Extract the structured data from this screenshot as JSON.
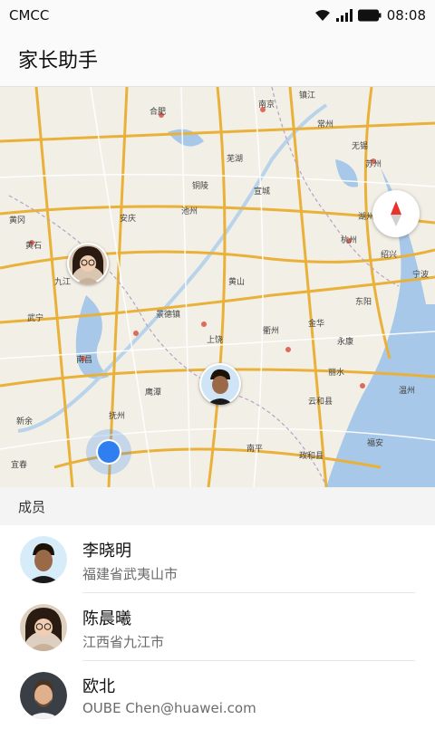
{
  "status": {
    "carrier": "CMCC",
    "time": "08:08"
  },
  "app": {
    "title": "家长助手"
  },
  "map": {
    "labels": [
      "合肥",
      "南京",
      "镇江",
      "常州",
      "无锡",
      "苏州",
      "安庆",
      "池州",
      "铜陵",
      "芜湖",
      "宣城",
      "黄山",
      "杭州",
      "绍兴",
      "宁波",
      "南昌",
      "景德镇",
      "上饶",
      "衢州",
      "金华",
      "丽水",
      "温州",
      "抚州",
      "鹰潭",
      "南平",
      "福安",
      "九江",
      "黄石",
      "武宁",
      "新余",
      "宜春",
      "黄冈",
      "嘉兴",
      "湖州",
      "东阳",
      "永康",
      "云和县",
      "政和县"
    ]
  },
  "section": {
    "members_label": "成员"
  },
  "members": [
    {
      "name": "李晓明",
      "location": "福建省武夷山市"
    },
    {
      "name": "陈晨曦",
      "location": "江西省九江市"
    },
    {
      "name": "欧北",
      "location": "OUBE Chen@huawei.com"
    }
  ],
  "colors": {
    "accent": "#2f7ff0",
    "compass_red": "#e8322c",
    "water": "#a7c8e8",
    "highway": "#e9b13a"
  }
}
